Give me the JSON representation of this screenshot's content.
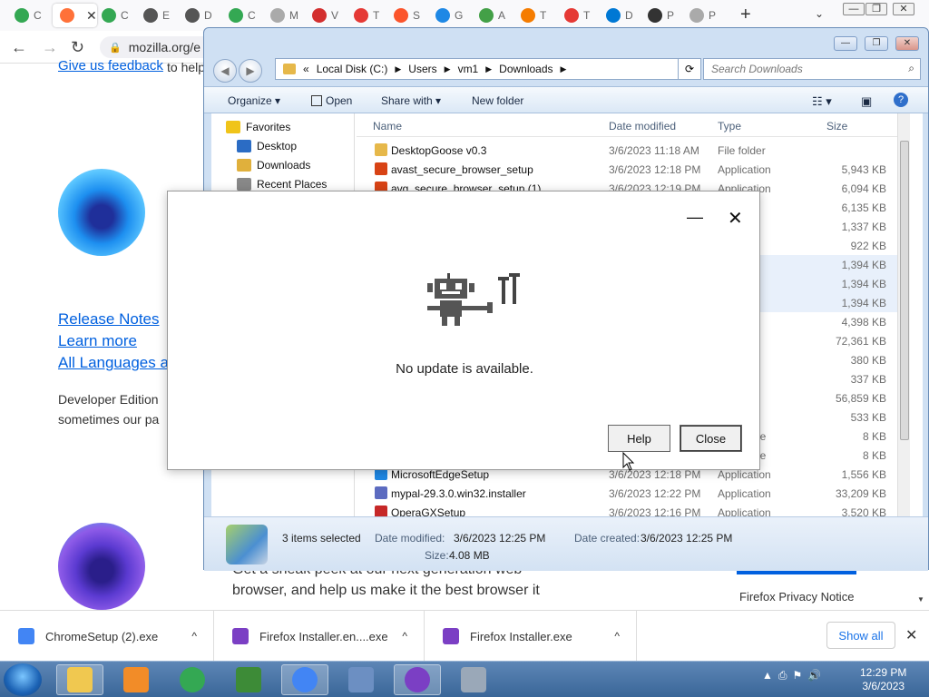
{
  "browser": {
    "tabs": [
      {
        "label": "C",
        "color": "#34a853"
      },
      {
        "label": "",
        "color": "#ff7139",
        "close": "✕"
      },
      {
        "label": "C",
        "color": "#34a853"
      },
      {
        "label": "E",
        "color": "#555555"
      },
      {
        "label": "D",
        "color": "#555555"
      },
      {
        "label": "C",
        "color": "#34a853"
      },
      {
        "label": "M",
        "color": "#aaaaaa"
      },
      {
        "label": "V",
        "color": "#d32f2f"
      },
      {
        "label": "T",
        "color": "#e53935"
      },
      {
        "label": "S",
        "color": "#fb542b"
      },
      {
        "label": "G",
        "color": "#1e88e5"
      },
      {
        "label": "A",
        "color": "#43a047"
      },
      {
        "label": "T",
        "color": "#f57c00"
      },
      {
        "label": "T",
        "color": "#e53935"
      },
      {
        "label": "D",
        "color": "#0078d4"
      },
      {
        "label": "P",
        "color": "#333333"
      },
      {
        "label": "P",
        "color": "#aaaaaa"
      }
    ],
    "new_tab": "+",
    "tab_list": "⌄",
    "window_controls": [
      "—",
      "❐",
      "✕"
    ],
    "url": "mozilla.org/e",
    "lock_icon": "🔒"
  },
  "page": {
    "feedback_link": "Give us feedback",
    "feedback_suffix": "to help",
    "release_notes": "Release Notes",
    "learn_more": "Learn more",
    "all_languages": "All Languages a",
    "dev_edition_text_1": "Developer Edition",
    "dev_edition_text_2": "sometimes our pa",
    "nightly_text_1": "Get a sneak peek at our next generation web",
    "nightly_text_2": "browser, and help us make it the best browser it",
    "privacy_notice": "Firefox Privacy Notice"
  },
  "explorer": {
    "caption_buttons": [
      "—",
      "❐",
      "✕"
    ],
    "nav_back": "◀",
    "nav_forward": "▶",
    "breadcrumb": [
      "«",
      "Local Disk (C:)",
      "Users",
      "vm1",
      "Downloads"
    ],
    "refresh": "⟳",
    "search_placeholder": "Search Downloads",
    "toolbar": {
      "organize": "Organize ▾",
      "open": "Open",
      "share_with": "Share with ▾",
      "new_folder": "New folder"
    },
    "nav_pane": [
      {
        "label": "Favorites",
        "color": "#f0c419"
      },
      {
        "label": "Desktop",
        "color": "#2b6cc4"
      },
      {
        "label": "Downloads",
        "color": "#e0b03c"
      },
      {
        "label": "Recent Places",
        "color": "#888888"
      }
    ],
    "columns": [
      "Name",
      "Date modified",
      "Type",
      "Size"
    ],
    "files": [
      {
        "name": "DesktopGoose v0.3",
        "date": "3/6/2023 11:18 AM",
        "type": "File folder",
        "size": "",
        "icon_color": "#e6b84a",
        "selected": false
      },
      {
        "name": "avast_secure_browser_setup",
        "date": "3/6/2023 12:18 PM",
        "type": "Application",
        "size": "5,943 KB",
        "icon_color": "#d84315",
        "selected": false
      },
      {
        "name": "avg_secure_browser_setup (1)",
        "date": "3/6/2023 12:19 PM",
        "type": "Application",
        "size": "6,094 KB",
        "icon_color": "#d84315",
        "selected": false
      },
      {
        "name": "",
        "date": "",
        "type": "on",
        "size": "6,135 KB",
        "icon_color": "",
        "selected": false
      },
      {
        "name": "",
        "date": "",
        "type": "on",
        "size": "1,337 KB",
        "icon_color": "",
        "selected": false
      },
      {
        "name": "",
        "date": "",
        "type": "on",
        "size": "922 KB",
        "icon_color": "",
        "selected": false
      },
      {
        "name": "",
        "date": "",
        "type": "on",
        "size": "1,394 KB",
        "icon_color": "",
        "selected": true
      },
      {
        "name": "",
        "date": "",
        "type": "on",
        "size": "1,394 KB",
        "icon_color": "",
        "selected": true
      },
      {
        "name": "",
        "date": "",
        "type": "on",
        "size": "1,394 KB",
        "icon_color": "",
        "selected": true
      },
      {
        "name": "",
        "date": "",
        "type": "on",
        "size": "4,398 KB",
        "icon_color": "",
        "selected": false
      },
      {
        "name": "",
        "date": "",
        "type": "on",
        "size": "72,361 KB",
        "icon_color": "",
        "selected": false
      },
      {
        "name": "",
        "date": "",
        "type": "on",
        "size": "380 KB",
        "icon_color": "",
        "selected": false
      },
      {
        "name": "",
        "date": "",
        "type": "on",
        "size": "337 KB",
        "icon_color": "",
        "selected": false
      },
      {
        "name": "",
        "date": "",
        "type": "on",
        "size": "56,859 KB",
        "icon_color": "",
        "selected": false
      },
      {
        "name": "",
        "date": "",
        "type": "on",
        "size": "533 KB",
        "icon_color": "",
        "selected": false
      },
      {
        "name": "",
        "date": "",
        "type": "Batch File",
        "size": "8 KB",
        "icon_color": "",
        "selected": false
      },
      {
        "name": "",
        "date": "",
        "type": "Batch File",
        "size": "8 KB",
        "icon_color": "",
        "selected": false
      },
      {
        "name": "MicrosoftEdgeSetup",
        "date": "3/6/2023 12:18 PM",
        "type": "Application",
        "size": "1,556 KB",
        "icon_color": "#1e88e5",
        "selected": false
      },
      {
        "name": "mypal-29.3.0.win32.installer",
        "date": "3/6/2023 12:22 PM",
        "type": "Application",
        "size": "33,209 KB",
        "icon_color": "#5c6bc0",
        "selected": false
      },
      {
        "name": "OperaGXSetup",
        "date": "3/6/2023 12:16 PM",
        "type": "Application",
        "size": "3,520 KB",
        "icon_color": "#c62828",
        "selected": false
      }
    ],
    "status": {
      "selection": "3 items selected",
      "date_modified_label": "Date modified:",
      "date_modified": "3/6/2023 12:25 PM",
      "date_created_label": "Date created:",
      "date_created": "3/6/2023 12:25 PM",
      "size_label": "Size:",
      "size": "4.08 MB"
    }
  },
  "dialog": {
    "minimize": "—",
    "close": "✕",
    "message": "No update is available.",
    "help": "Help",
    "close_button": "Close"
  },
  "downloads": {
    "items": [
      {
        "name": "ChromeSetup (2).exe",
        "color": "#4285f4"
      },
      {
        "name": "Firefox Installer.en....exe",
        "color": "#7b3fc4"
      },
      {
        "name": "Firefox Installer.exe",
        "color": "#7b3fc4"
      }
    ],
    "chevron": "^",
    "show_all": "Show all",
    "close": "✕"
  },
  "taskbar": {
    "items": [
      {
        "name": "explorer",
        "color": "#f0c850",
        "active": true
      },
      {
        "name": "media",
        "color": "#f28c28",
        "active": false
      },
      {
        "name": "chrome",
        "color": "#34a853",
        "active": false
      },
      {
        "name": "csharp",
        "color": "#3d8b37",
        "active": false
      },
      {
        "name": "chrome-2",
        "color": "#4285f4",
        "active": true
      },
      {
        "name": "control-panel",
        "color": "#6c8fc2",
        "active": false
      },
      {
        "name": "firefox",
        "color": "#7b3fc4",
        "active": true
      },
      {
        "name": "installer",
        "color": "#9aa8b8",
        "active": false
      }
    ],
    "tray_icons": [
      "▲",
      "⎙",
      "⚑",
      "🔊"
    ],
    "time": "12:29 PM",
    "date": "3/6/2023"
  }
}
